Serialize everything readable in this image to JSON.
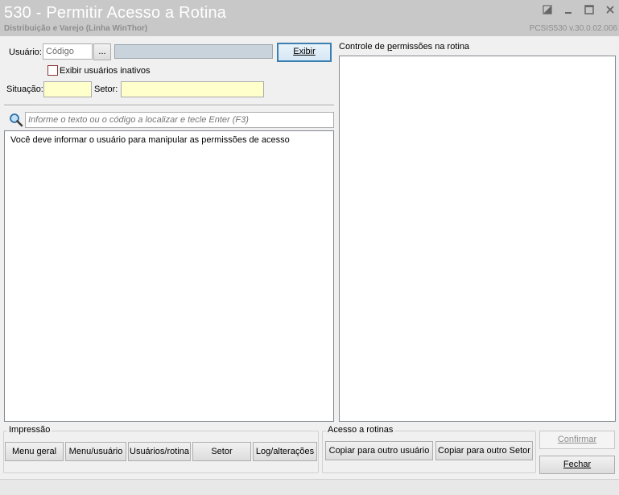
{
  "window": {
    "title": "530 - Permitir Acesso a Rotina",
    "subtitle": "Distribuição e Varejo (Linha WinThor)",
    "version": "PCSIS530  v.30.0.02.006"
  },
  "form": {
    "usuario_label": "Usuário:",
    "codigo_placeholder": "Código",
    "ellipsis_label": "...",
    "name_value": "",
    "exibir_label": "Exibir",
    "inativos_label": "Exibir usuários inativos",
    "situacao_label": "Situação:",
    "situacao_value": "",
    "setor_label": "Setor:",
    "setor_value": ""
  },
  "search": {
    "placeholder": "Informe o texto ou o código a localizar e tecle Enter (F3)"
  },
  "list_panel": {
    "message": "Você deve informar o usuário para manipular as permissões de acesso"
  },
  "permissions_panel": {
    "label": "Controle de permissões na rotina"
  },
  "impressao": {
    "title": "Impressão",
    "buttons": [
      "Menu geral",
      "Menu/usuário",
      "Usuários/rotina",
      "Setor",
      "Log/alterações"
    ]
  },
  "acesso": {
    "title": "Acesso a rotinas",
    "copy_user": "Copiar para outro usuário",
    "copy_setor": "Copiar para outro Setor"
  },
  "actions": {
    "confirmar": "Confirmar",
    "fechar": "Fechar"
  },
  "icons": {
    "restore": "restore-icon",
    "minimize": "minimize-icon",
    "maximize": "maximize-icon",
    "close": "close-icon",
    "search": "search-icon"
  }
}
